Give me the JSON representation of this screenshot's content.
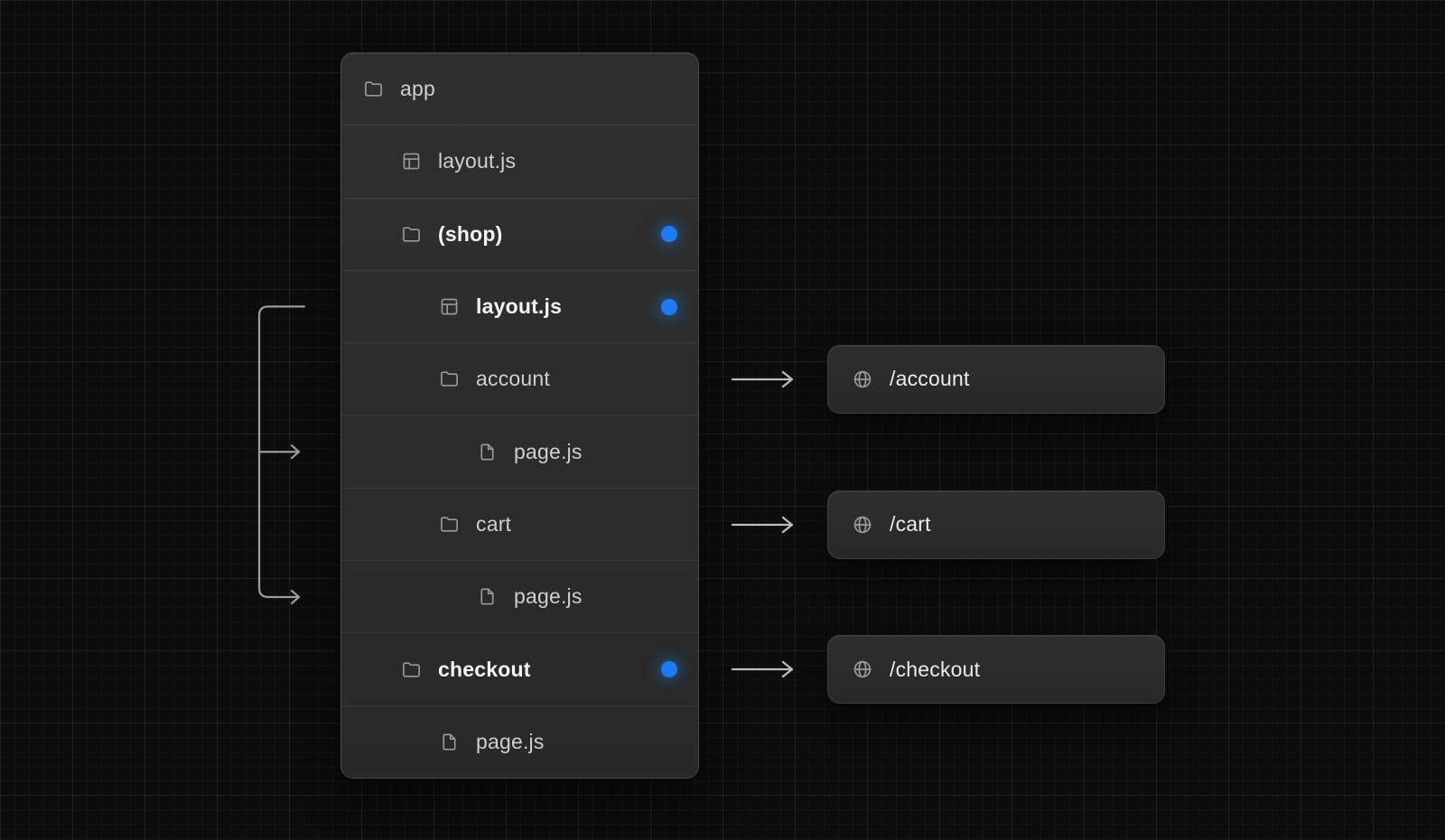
{
  "diagram_title": "route-groups-file-tree",
  "file_tree": {
    "rows": [
      {
        "label": "app",
        "icon": "folder",
        "indent": 0,
        "bold": false,
        "dot": false
      },
      {
        "label": "layout.js",
        "icon": "layout",
        "indent": 1,
        "bold": false,
        "dot": false
      },
      {
        "label": "(shop)",
        "icon": "folder",
        "indent": 1,
        "bold": true,
        "dot": true
      },
      {
        "label": "layout.js",
        "icon": "layout",
        "indent": 2,
        "bold": true,
        "dot": true
      },
      {
        "label": "account",
        "icon": "folder",
        "indent": 2,
        "bold": false,
        "dot": false
      },
      {
        "label": "page.js",
        "icon": "file",
        "indent": 3,
        "bold": false,
        "dot": false
      },
      {
        "label": "cart",
        "icon": "folder",
        "indent": 2,
        "bold": false,
        "dot": false
      },
      {
        "label": "page.js",
        "icon": "file",
        "indent": 3,
        "bold": false,
        "dot": false
      },
      {
        "label": "checkout",
        "icon": "folder",
        "indent": 1,
        "bold": true,
        "dot": true
      },
      {
        "label": "page.js",
        "icon": "file",
        "indent": 2,
        "bold": false,
        "dot": false
      }
    ]
  },
  "routes": [
    {
      "label": "/account",
      "icon": "globe",
      "tree_row": 4
    },
    {
      "label": "/cart",
      "icon": "globe",
      "tree_row": 6
    },
    {
      "label": "/checkout",
      "icon": "globe",
      "tree_row": 8
    }
  ],
  "connector": {
    "layout_row": 3,
    "branch_rows": [
      5,
      7
    ]
  },
  "colors": {
    "background": "#0c0c0c",
    "panel_bg": "#2c2c2c",
    "panel_border": "#474747",
    "text_normal": "#cfcfcf",
    "text_bold": "#f5f5f5",
    "icon_gray": "#9a9a9a",
    "accent_blue": "#1e7af2",
    "connector_gray": "#9b9b9b",
    "arrow_gray": "#bdbdbd"
  }
}
